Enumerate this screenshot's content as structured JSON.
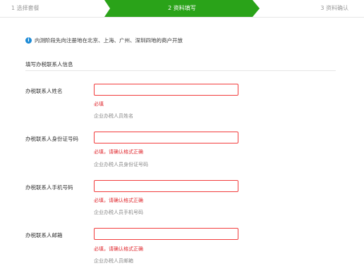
{
  "stepper": {
    "steps": [
      {
        "label": "1  选择套餐",
        "state": "done"
      },
      {
        "label": "2  资料填写",
        "state": "active"
      },
      {
        "label": "3  资料确认",
        "state": "pending"
      }
    ],
    "active_color": "#2aa319"
  },
  "notice": {
    "icon": "info-icon",
    "text": "内测阶段先向注册地在北京、上海、广州、深圳四地的商户开放"
  },
  "section": {
    "title": "填写办税联系人信息"
  },
  "fields": [
    {
      "label": "办税联系人姓名",
      "value": "",
      "error": "必填",
      "hint": "企业办税人员姓名"
    },
    {
      "label": "办税联系人身份证号码",
      "value": "",
      "error": "必填，请确认格式正确",
      "hint": "企业办税人员身份证号码"
    },
    {
      "label": "办税联系人手机号码",
      "value": "",
      "error": "必填，请确认格式正确",
      "hint": "企业办税人员手机号码"
    },
    {
      "label": "办税联系人邮箱",
      "value": "",
      "error": "必填，请确认格式正确",
      "hint": "企业办税人员邮箱"
    }
  ],
  "colors": {
    "error": "#e0282e",
    "input_border_error": "#f23c3c",
    "info": "#1b8ad6"
  }
}
